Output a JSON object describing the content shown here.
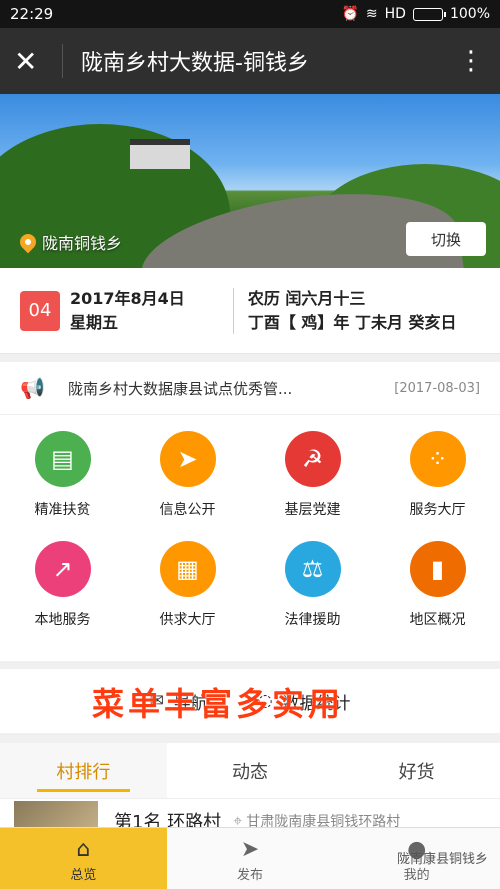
{
  "status": {
    "time": "22:29",
    "signal": "HD",
    "battery": "100%"
  },
  "header": {
    "close": "✕",
    "title": "陇南乡村大数据-铜钱乡",
    "more": "⋮"
  },
  "banner": {
    "location": "陇南铜钱乡",
    "switch_label": "切换"
  },
  "date": {
    "day": "04",
    "date": "2017年8月4日",
    "weekday": "星期五",
    "lunar": "农历 闰六月十三",
    "ganzhi": "丁酉【 鸡】年 丁未月 癸亥日"
  },
  "notice": {
    "text": "陇南乡村大数据康县试点优秀管...",
    "date": "[2017-08-03]"
  },
  "grid": [
    {
      "label": "精准扶贫",
      "icon": "book-icon",
      "glyph": "▤",
      "color": "#4caf50"
    },
    {
      "label": "信息公开",
      "icon": "paper-plane-icon",
      "glyph": "➤",
      "color": "#ff9800"
    },
    {
      "label": "基层党建",
      "icon": "party-emblem-icon",
      "glyph": "☭",
      "color": "#e53935"
    },
    {
      "label": "服务大厅",
      "icon": "grid-dots-icon",
      "glyph": "⁘",
      "color": "#ff9800"
    },
    {
      "label": "本地服务",
      "icon": "chart-icon",
      "glyph": "↗",
      "color": "#ec407a"
    },
    {
      "label": "供求大厅",
      "icon": "store-icon",
      "glyph": "▦",
      "color": "#ff9800"
    },
    {
      "label": "法律援助",
      "icon": "scales-icon",
      "glyph": "⚖",
      "color": "#29a8e0"
    },
    {
      "label": "地区概况",
      "icon": "book-closed-icon",
      "glyph": "▮",
      "color": "#ef6c00"
    }
  ],
  "promo": {
    "left_label": "导航",
    "right_label": "数据统计",
    "overlay": "菜单丰富多实用"
  },
  "tabs": [
    "村排行",
    "动态",
    "好货"
  ],
  "village": {
    "rank": "第1名 环路村",
    "address": "甘肃陇南康县铜钱环路村"
  },
  "bottom_nav": [
    {
      "label": "总览",
      "icon": "home-icon",
      "glyph": "⌂"
    },
    {
      "label": "发布",
      "icon": "send-icon",
      "glyph": "➤"
    },
    {
      "label": "我的",
      "icon": "user-icon",
      "glyph": "●"
    }
  ],
  "watermark": "陇南康县铜钱乡"
}
